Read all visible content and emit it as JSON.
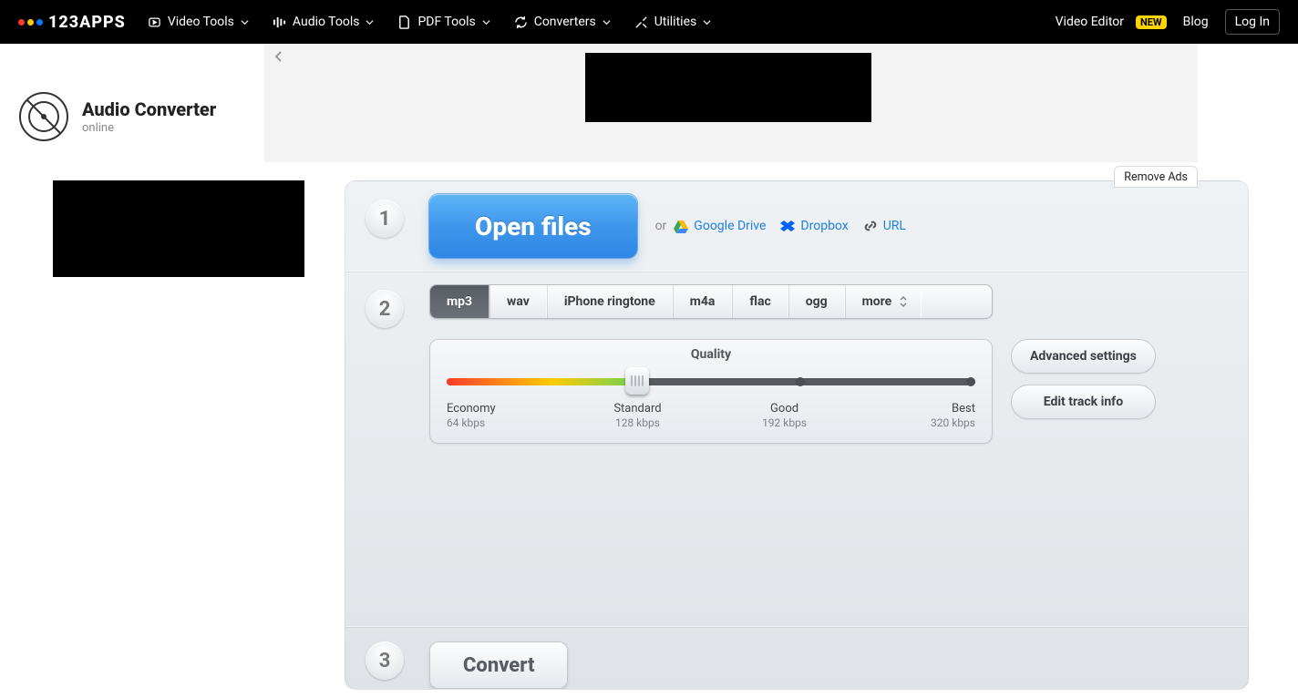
{
  "brand": "123APPS",
  "topnav": {
    "video_tools": "Video Tools",
    "audio_tools": "Audio Tools",
    "pdf_tools": "PDF Tools",
    "converters": "Converters",
    "utilities": "Utilities"
  },
  "topright": {
    "video_editor": "Video Editor",
    "new_badge": "NEW",
    "blog": "Blog",
    "login": "Log In"
  },
  "app": {
    "title": "Audio Converter",
    "subtitle": "online"
  },
  "remove_ads": "Remove Ads",
  "step1": {
    "number": "1",
    "open_files": "Open files",
    "or": "or",
    "google_drive": "Google Drive",
    "dropbox": "Dropbox",
    "url": "URL"
  },
  "step2": {
    "number": "2",
    "formats": {
      "mp3": "mp3",
      "wav": "wav",
      "iphone": "iPhone ringtone",
      "m4a": "m4a",
      "flac": "flac",
      "ogg": "ogg",
      "more": "more"
    },
    "quality_title": "Quality",
    "quality": {
      "economy": "Economy",
      "economy_rate": "64 kbps",
      "standard": "Standard",
      "standard_rate": "128 kbps",
      "good": "Good",
      "good_rate": "192 kbps",
      "best": "Best",
      "best_rate": "320 kbps"
    },
    "advanced": "Advanced settings",
    "edit_track": "Edit track info"
  },
  "step3": {
    "number": "3",
    "convert": "Convert"
  }
}
